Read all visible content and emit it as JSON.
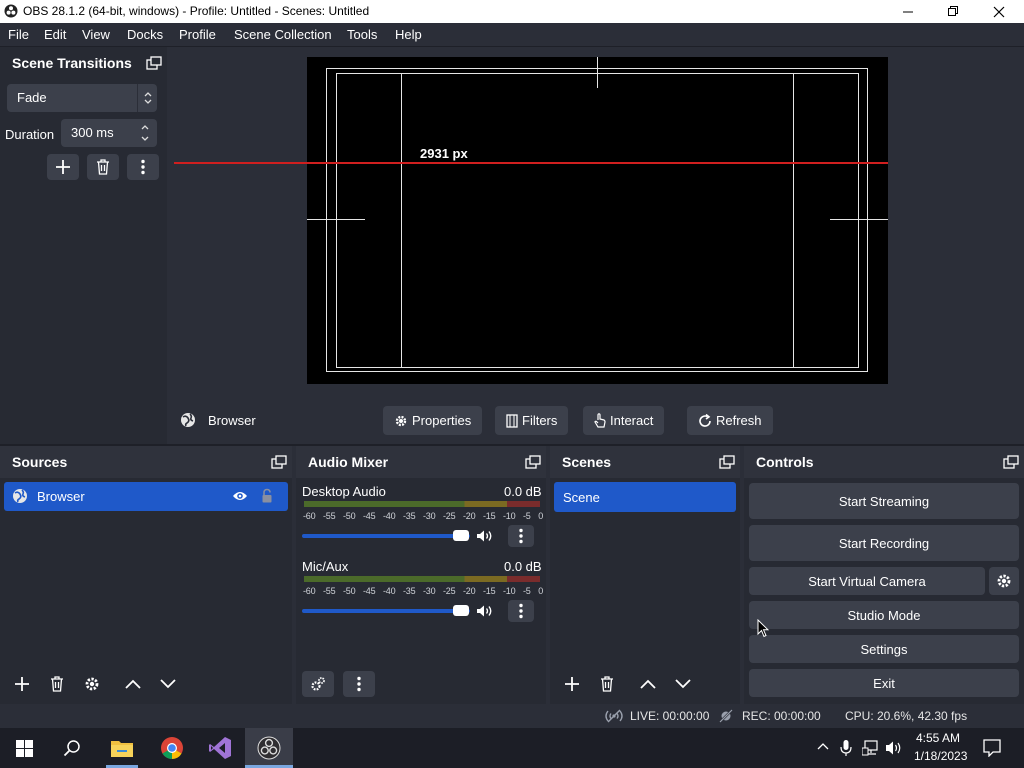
{
  "window": {
    "title": "OBS 28.1.2 (64-bit, windows) - Profile: Untitled - Scenes: Untitled",
    "minimize_icon": "minimize-icon",
    "maximize_icon": "restore-icon",
    "close_icon": "close-icon"
  },
  "menu": [
    "File",
    "Edit",
    "View",
    "Docks",
    "Profile",
    "Scene Collection",
    "Tools",
    "Help"
  ],
  "scene_transitions": {
    "title": "Scene Transitions",
    "transition": "Fade",
    "duration_label": "Duration",
    "duration_value": "300 ms"
  },
  "preview": {
    "measure_label": "2931 px",
    "guide_color": "#d01f1f"
  },
  "context_bar": {
    "source_name": "Browser",
    "properties": "Properties",
    "filters": "Filters",
    "interact": "Interact",
    "refresh": "Refresh"
  },
  "sources": {
    "title": "Sources",
    "items": [
      {
        "name": "Browser",
        "visible": true,
        "locked": false
      }
    ]
  },
  "audio_mixer": {
    "title": "Audio Mixer",
    "scale": [
      "-60",
      "-55",
      "-50",
      "-45",
      "-40",
      "-35",
      "-30",
      "-25",
      "-20",
      "-15",
      "-10",
      "-5",
      "0"
    ],
    "channels": [
      {
        "name": "Desktop Audio",
        "level": "0.0 dB",
        "volume_fraction": 1.0
      },
      {
        "name": "Mic/Aux",
        "level": "0.0 dB",
        "volume_fraction": 1.0
      }
    ]
  },
  "scenes": {
    "title": "Scenes",
    "items": [
      "Scene"
    ]
  },
  "controls": {
    "title": "Controls",
    "start_streaming": "Start Streaming",
    "start_recording": "Start Recording",
    "start_virtual_camera": "Start Virtual Camera",
    "studio_mode": "Studio Mode",
    "settings": "Settings",
    "exit": "Exit"
  },
  "status": {
    "live": "LIVE: 00:00:00",
    "rec": "REC: 00:00:00",
    "cpu": "CPU: 20.6%, 42.30 fps"
  },
  "taskbar": {
    "time": "4:55 AM",
    "date": "1/18/2023"
  },
  "colors": {
    "accent": "#1f59c9",
    "panel": "#272a33",
    "button": "#3c404b"
  }
}
